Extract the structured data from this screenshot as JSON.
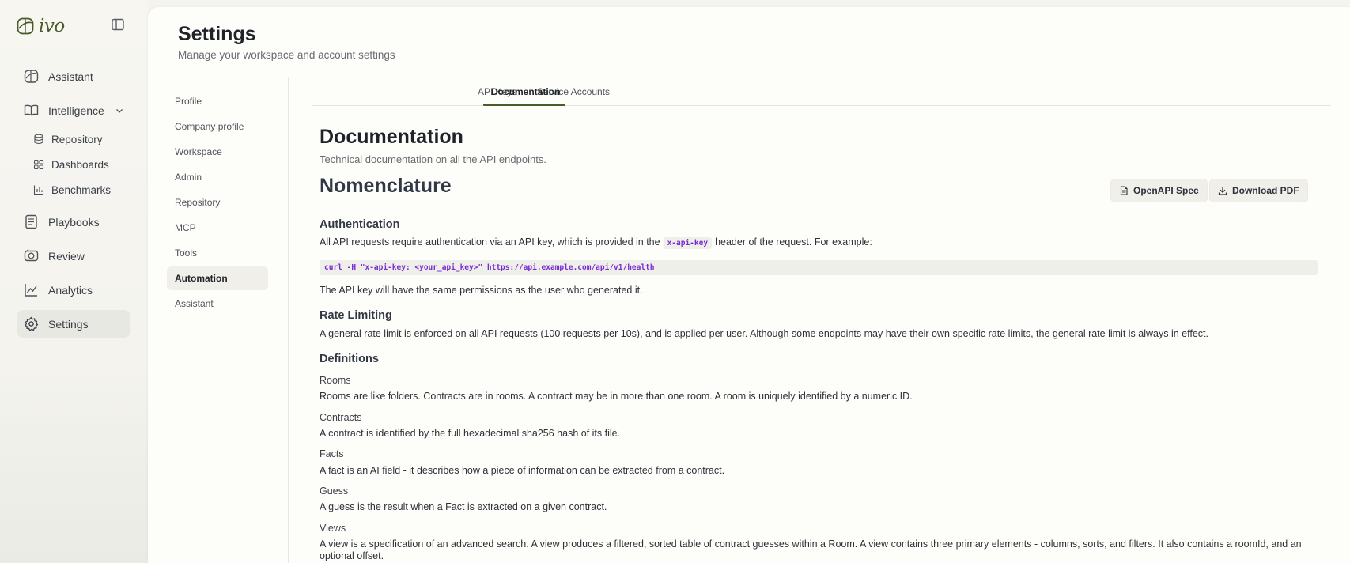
{
  "app": {
    "logo_text": "ivo",
    "nav": [
      {
        "label": "Assistant",
        "icon": "assistant-icon"
      },
      {
        "label": "Intelligence",
        "icon": "book-icon",
        "expanded": true,
        "children": [
          {
            "label": "Repository",
            "icon": "database-icon"
          },
          {
            "label": "Dashboards",
            "icon": "grid-icon"
          },
          {
            "label": "Benchmarks",
            "icon": "bar-chart-icon"
          }
        ]
      },
      {
        "label": "Playbooks",
        "icon": "playbook-icon"
      },
      {
        "label": "Review",
        "icon": "review-icon"
      },
      {
        "label": "Analytics",
        "icon": "line-chart-icon"
      },
      {
        "label": "Settings",
        "icon": "gear-icon",
        "active": true
      }
    ]
  },
  "settings": {
    "title": "Settings",
    "subtitle": "Manage your workspace and account settings",
    "nav": [
      "Profile",
      "Company profile",
      "Workspace",
      "Admin",
      "Repository",
      "MCP",
      "Tools",
      "Automation",
      "Assistant"
    ],
    "active_nav": "Automation"
  },
  "tabs": [
    "API Keys",
    "Service Accounts",
    "Documentation"
  ],
  "active_tab": "Documentation",
  "doc": {
    "title": "Documentation",
    "subtitle": "Technical documentation on all the API endpoints.",
    "nomenclature": "Nomenclature",
    "buttons": {
      "openapi": "OpenAPI Spec",
      "pdf": "Download PDF"
    },
    "auth": {
      "heading": "Authentication",
      "text_before": "All API requests require authentication via an API key, which is provided in the",
      "code": "x-api-key",
      "text_after": "header of the request. For example:",
      "example": "curl -H \"x-api-key: <your_api_key>\" https://api.example.com/api/v1/health",
      "note": "The API key will have the same permissions as the user who generated it."
    },
    "rate": {
      "heading": "Rate Limiting",
      "text": "A general rate limit is enforced on all API requests (100 requests per 10s), and is applied per user. Although some endpoints may have their own specific rate limits, the general rate limit is always in effect."
    },
    "definitions": {
      "heading": "Definitions",
      "items": [
        {
          "term": "Rooms",
          "text": "Rooms are like folders. Contracts are in rooms. A contract may be in more than one room. A room is uniquely identified by a numeric ID."
        },
        {
          "term": "Contracts",
          "text": "A contract is identified by the full hexadecimal sha256 hash of its file."
        },
        {
          "term": "Facts",
          "text": "A fact is an AI field - it describes how a piece of information can be extracted from a contract."
        },
        {
          "term": "Guess",
          "text": "A guess is the result when a Fact is extracted on a given contract."
        },
        {
          "term": "Views",
          "text": "A view is a specification of an advanced search. A view produces a filtered, sorted table of contract guesses within a Room. A view contains three primary elements - columns, sorts, and filters. It also contains a roomId, and an optional offset."
        }
      ]
    }
  },
  "colors": {
    "accent": "#4a5b2c",
    "code": "#7a2bd6"
  }
}
